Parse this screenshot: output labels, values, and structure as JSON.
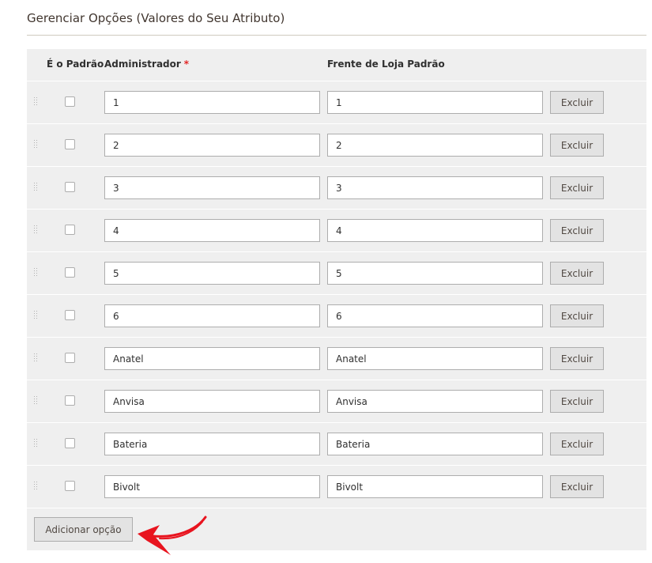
{
  "section": {
    "title": "Gerenciar Opções (Valores do Seu Atributo)"
  },
  "table": {
    "headers": {
      "default": "É o Padrão",
      "admin": "Administrador",
      "admin_required_marker": "*",
      "store": "Frente de Loja Padrão"
    },
    "rows": [
      {
        "admin": "1",
        "store": "1",
        "delete_label": "Excluir",
        "is_default": false
      },
      {
        "admin": "2",
        "store": "2",
        "delete_label": "Excluir",
        "is_default": false
      },
      {
        "admin": "3",
        "store": "3",
        "delete_label": "Excluir",
        "is_default": false
      },
      {
        "admin": "4",
        "store": "4",
        "delete_label": "Excluir",
        "is_default": false
      },
      {
        "admin": "5",
        "store": "5",
        "delete_label": "Excluir",
        "is_default": false
      },
      {
        "admin": "6",
        "store": "6",
        "delete_label": "Excluir",
        "is_default": false
      },
      {
        "admin": "Anatel",
        "store": "Anatel",
        "delete_label": "Excluir",
        "is_default": false
      },
      {
        "admin": "Anvisa",
        "store": "Anvisa",
        "delete_label": "Excluir",
        "is_default": false
      },
      {
        "admin": "Bateria",
        "store": "Bateria",
        "delete_label": "Excluir",
        "is_default": false
      },
      {
        "admin": "Bivolt",
        "store": "Bivolt",
        "delete_label": "Excluir",
        "is_default": false
      }
    ],
    "add_button_label": "Adicionar opção"
  },
  "colors": {
    "required_marker": "#e22626",
    "annotation_arrow": "#e8141f",
    "table_background": "#efefef",
    "button_background": "#e3e3e3"
  },
  "icons": {
    "drag_handle": "drag-handle-icon",
    "annotation": "red-arrow-icon"
  }
}
